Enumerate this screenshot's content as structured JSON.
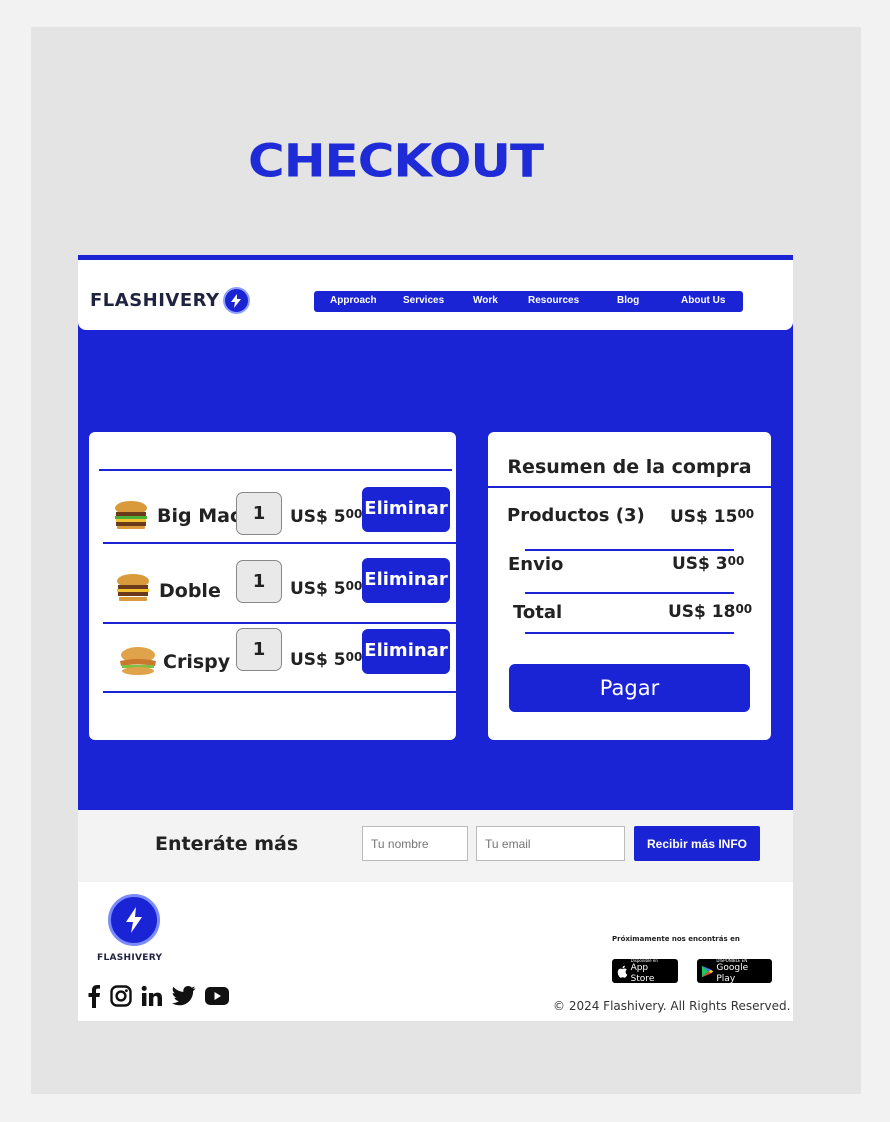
{
  "page": {
    "heading": "CHECKOUT"
  },
  "header": {
    "brand": "FLASHIVERY",
    "nav": [
      "Approach",
      "Services",
      "Work",
      "Resources",
      "Blog",
      "About Us"
    ]
  },
  "cart": {
    "items": [
      {
        "name": "Big Mac",
        "icon": "burger-icon",
        "qty": "1",
        "price_main": "US$ 5",
        "price_cents": "00",
        "remove_label": "Eliminar"
      },
      {
        "name": "Doble",
        "icon": "burger-icon",
        "qty": "1",
        "price_main": "US$ 5",
        "price_cents": "00",
        "remove_label": "Eliminar"
      },
      {
        "name": "Crispy",
        "icon": "chicken-sandwich-icon",
        "qty": "1",
        "price_main": "US$ 5",
        "price_cents": "00",
        "remove_label": "Eliminar"
      }
    ]
  },
  "summary": {
    "title": "Resumen de la compra",
    "rows": [
      {
        "label": "Productos (3)",
        "value_main": "US$ 15",
        "value_cents": "00"
      },
      {
        "label": "Envio",
        "value_main": "US$ 3",
        "value_cents": "00"
      },
      {
        "label": "Total",
        "value_main": "US$ 18",
        "value_cents": "00"
      }
    ],
    "pay_label": "Pagar"
  },
  "newsletter": {
    "title": "Enteráte más",
    "name_placeholder": "Tu nombre",
    "email_placeholder": "Tu email",
    "button_label": "Recibir más INFO"
  },
  "footer": {
    "brand": "FLASHIVERY",
    "soon": "Próximamente nos encontrás en",
    "appstore_small": "Disponible en",
    "appstore_big": "App Store",
    "googleplay_small": "DISPONIBLE EN",
    "googleplay_big": "Google Play",
    "copyright": "© 2024 Flashivery. All Rights Reserved.",
    "socials": [
      "facebook-icon",
      "instagram-icon",
      "linkedin-icon",
      "twitter-icon",
      "youtube-icon"
    ]
  },
  "colors": {
    "brand_blue": "#1a24d4",
    "title_blue": "#1e2bd6",
    "page_bg": "#e4e4e4"
  }
}
